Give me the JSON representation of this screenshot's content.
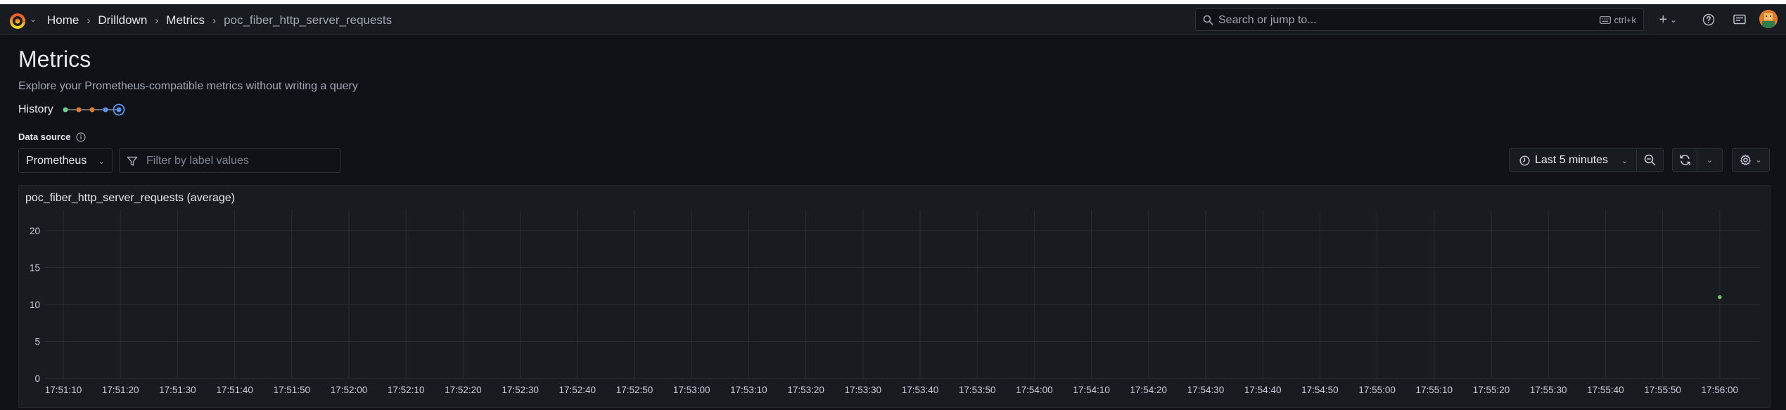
{
  "nav": {
    "breadcrumbs": [
      "Home",
      "Drilldown",
      "Metrics",
      "poc_fiber_http_server_requests"
    ],
    "search_placeholder": "Search or jump to...",
    "search_shortcut": "ctrl+k"
  },
  "page": {
    "title": "Metrics",
    "subtitle": "Explore your Prometheus-compatible metrics without writing a query",
    "history_label": "History",
    "history_dot_colors": [
      "#6ccf8e",
      "#e07b2a",
      "#e07b2a",
      "#5794f2",
      "#5794f2"
    ]
  },
  "controls": {
    "datasource_label": "Data source",
    "datasource_value": "Prometheus",
    "filter_placeholder": "Filter by label values",
    "time_range": "Last 5 minutes"
  },
  "panel": {
    "title": "poc_fiber_http_server_requests (average)"
  },
  "chart_data": {
    "type": "scatter",
    "title": "poc_fiber_http_server_requests (average)",
    "xlabel": "",
    "ylabel": "",
    "ylim": [
      0,
      22
    ],
    "yticks": [
      0,
      5,
      10,
      15,
      20
    ],
    "xticks": [
      "17:51:10",
      "17:51:20",
      "17:51:30",
      "17:51:40",
      "17:51:50",
      "17:52:00",
      "17:52:10",
      "17:52:20",
      "17:52:30",
      "17:52:40",
      "17:52:50",
      "17:53:00",
      "17:53:10",
      "17:53:20",
      "17:53:30",
      "17:53:40",
      "17:53:50",
      "17:54:00",
      "17:54:10",
      "17:54:20",
      "17:54:30",
      "17:54:40",
      "17:54:50",
      "17:55:00",
      "17:55:10",
      "17:55:20",
      "17:55:30",
      "17:55:40",
      "17:55:50",
      "17:56:00"
    ],
    "series": [
      {
        "color": "#73bf69",
        "points": [
          {
            "x": "17:56:00",
            "y": 11
          }
        ]
      }
    ],
    "grid": true
  }
}
